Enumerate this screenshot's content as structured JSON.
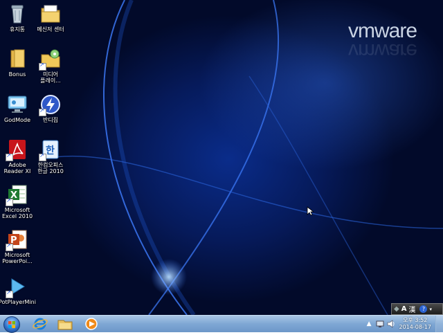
{
  "wallpaper": {
    "brand": "vmware"
  },
  "icons": [
    {
      "name": "recycle-bin",
      "label": "휴지통",
      "label2": ""
    },
    {
      "name": "messenger-center",
      "label": "메신저 센터",
      "label2": ""
    },
    {
      "name": "bonus-folder",
      "label": "Bonus",
      "label2": ""
    },
    {
      "name": "media-player",
      "label": "미디어",
      "label2": "플레이..."
    },
    {
      "name": "godmode",
      "label": "GodMode",
      "label2": ""
    },
    {
      "name": "bandizip",
      "label": "반디집",
      "label2": ""
    },
    {
      "name": "adobe-reader",
      "label": "Adobe",
      "label2": "Reader XI"
    },
    {
      "name": "hancom-office",
      "label": "한컴오피스",
      "label2": "한글 2010"
    },
    {
      "name": "excel-2010",
      "label": "Microsoft",
      "label2": "Excel 2010"
    },
    {
      "name": "powerpoint",
      "label": "Microsoft",
      "label2": "PowerPoi..."
    },
    {
      "name": "potplayer",
      "label": "PotPlayerMini",
      "label2": ""
    }
  ],
  "langbar": {
    "mode": "A",
    "hanja": "漢",
    "help": "?"
  },
  "taskbar": {
    "pinned": [
      "internet-explorer",
      "windows-explorer",
      "media-player"
    ],
    "clock": {
      "time": "오후 3:52",
      "date": "2014-08-17"
    }
  },
  "colors": {
    "taskbar": "#7ea7d4",
    "desktop": "#061a5a"
  }
}
